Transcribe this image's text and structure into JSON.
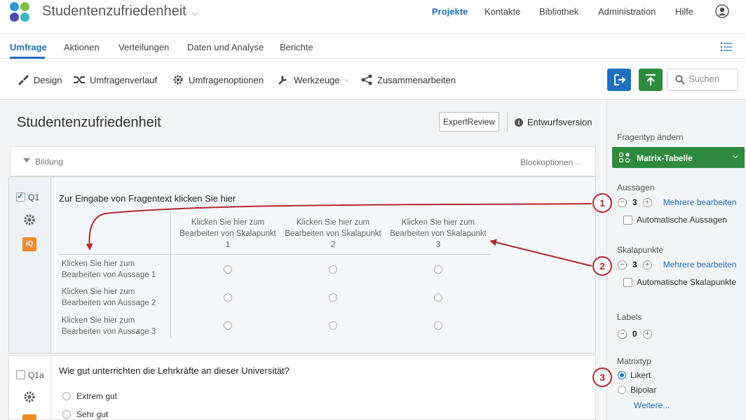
{
  "app": {
    "title": "Studentenzufriedenheit",
    "logo_colors": [
      "#2e9ad0",
      "#7cc243",
      "#4b4ba8",
      "#36b7c8"
    ]
  },
  "topnav": {
    "items": [
      "Projekte",
      "Kontakte",
      "Bibliothek",
      "Administration",
      "Hilfe"
    ],
    "active": "Projekte"
  },
  "tabs": {
    "items": [
      "Umfrage",
      "Aktionen",
      "Verteilungen",
      "Daten und Analyse",
      "Berichte"
    ],
    "active": "Umfrage"
  },
  "toolbar": {
    "items": [
      "Design",
      "Umfragenverlauf",
      "Umfragenoptionen",
      "Werkzeuge",
      "Zusammenarbeiten"
    ],
    "search_placeholder": "Suchen"
  },
  "survey": {
    "title": "Studentenzufriedenheit",
    "expert_review": "ExpertReview",
    "status": "Entwurfsversion",
    "block": {
      "name": "Bildung",
      "options": "Blockoptionen"
    }
  },
  "q1": {
    "id": "Q1",
    "checked": true,
    "text": "Zur Eingabe von Fragentext klicken Sie hier",
    "scale_points": [
      {
        "line1": "Klicken Sie hier zum",
        "line2": "Bearbeiten von Skalapunkt",
        "line3": "1"
      },
      {
        "line1": "Klicken Sie hier zum",
        "line2": "Bearbeiten von Skalapunkt",
        "line3": "2"
      },
      {
        "line1": "Klicken Sie hier zum",
        "line2": "Bearbeiten von Skalapunkt",
        "line3": "3"
      }
    ],
    "statements": [
      {
        "line1": "Klicken Sie hier zum",
        "line2": "Bearbeiten von Aussage 1"
      },
      {
        "line1": "Klicken Sie hier zum",
        "line2": "Bearbeiten von Aussage 2"
      },
      {
        "line1": "Klicken Sie hier zum",
        "line2": "Bearbeiten von Aussage 3"
      }
    ],
    "badge": "iQ"
  },
  "q1a": {
    "id": "Q1a",
    "checked": false,
    "text": "Wie gut unterrichten die Lehrkräfte an dieser Universität?",
    "choices": [
      "Extrem gut",
      "Sehr gut"
    ]
  },
  "panel": {
    "change_type_label": "Fragentyp ändern",
    "type_name": "Matrix-Tabelle",
    "statements_label": "Aussagen",
    "statements_count": "3",
    "edit_multiple": "Mehrere bearbeiten",
    "auto_statements": "Automatische Aussagen",
    "scale_label": "Skalapunkte",
    "scale_count": "3",
    "auto_scale": "Automatische Skalapunkte",
    "labels_label": "Labels",
    "labels_count": "0",
    "matrix_type_label": "Matrixtyp",
    "matrix_types": [
      "Likert",
      "Bipolar"
    ],
    "selected_matrix_type": "Likert",
    "more": "Weitere..."
  },
  "annotations": {
    "markers": [
      "1",
      "2",
      "3"
    ],
    "color": "#b22a30"
  },
  "colors": {
    "accent": "#1e6fbf",
    "green": "#2e8b3e",
    "orange": "#f08a24"
  }
}
